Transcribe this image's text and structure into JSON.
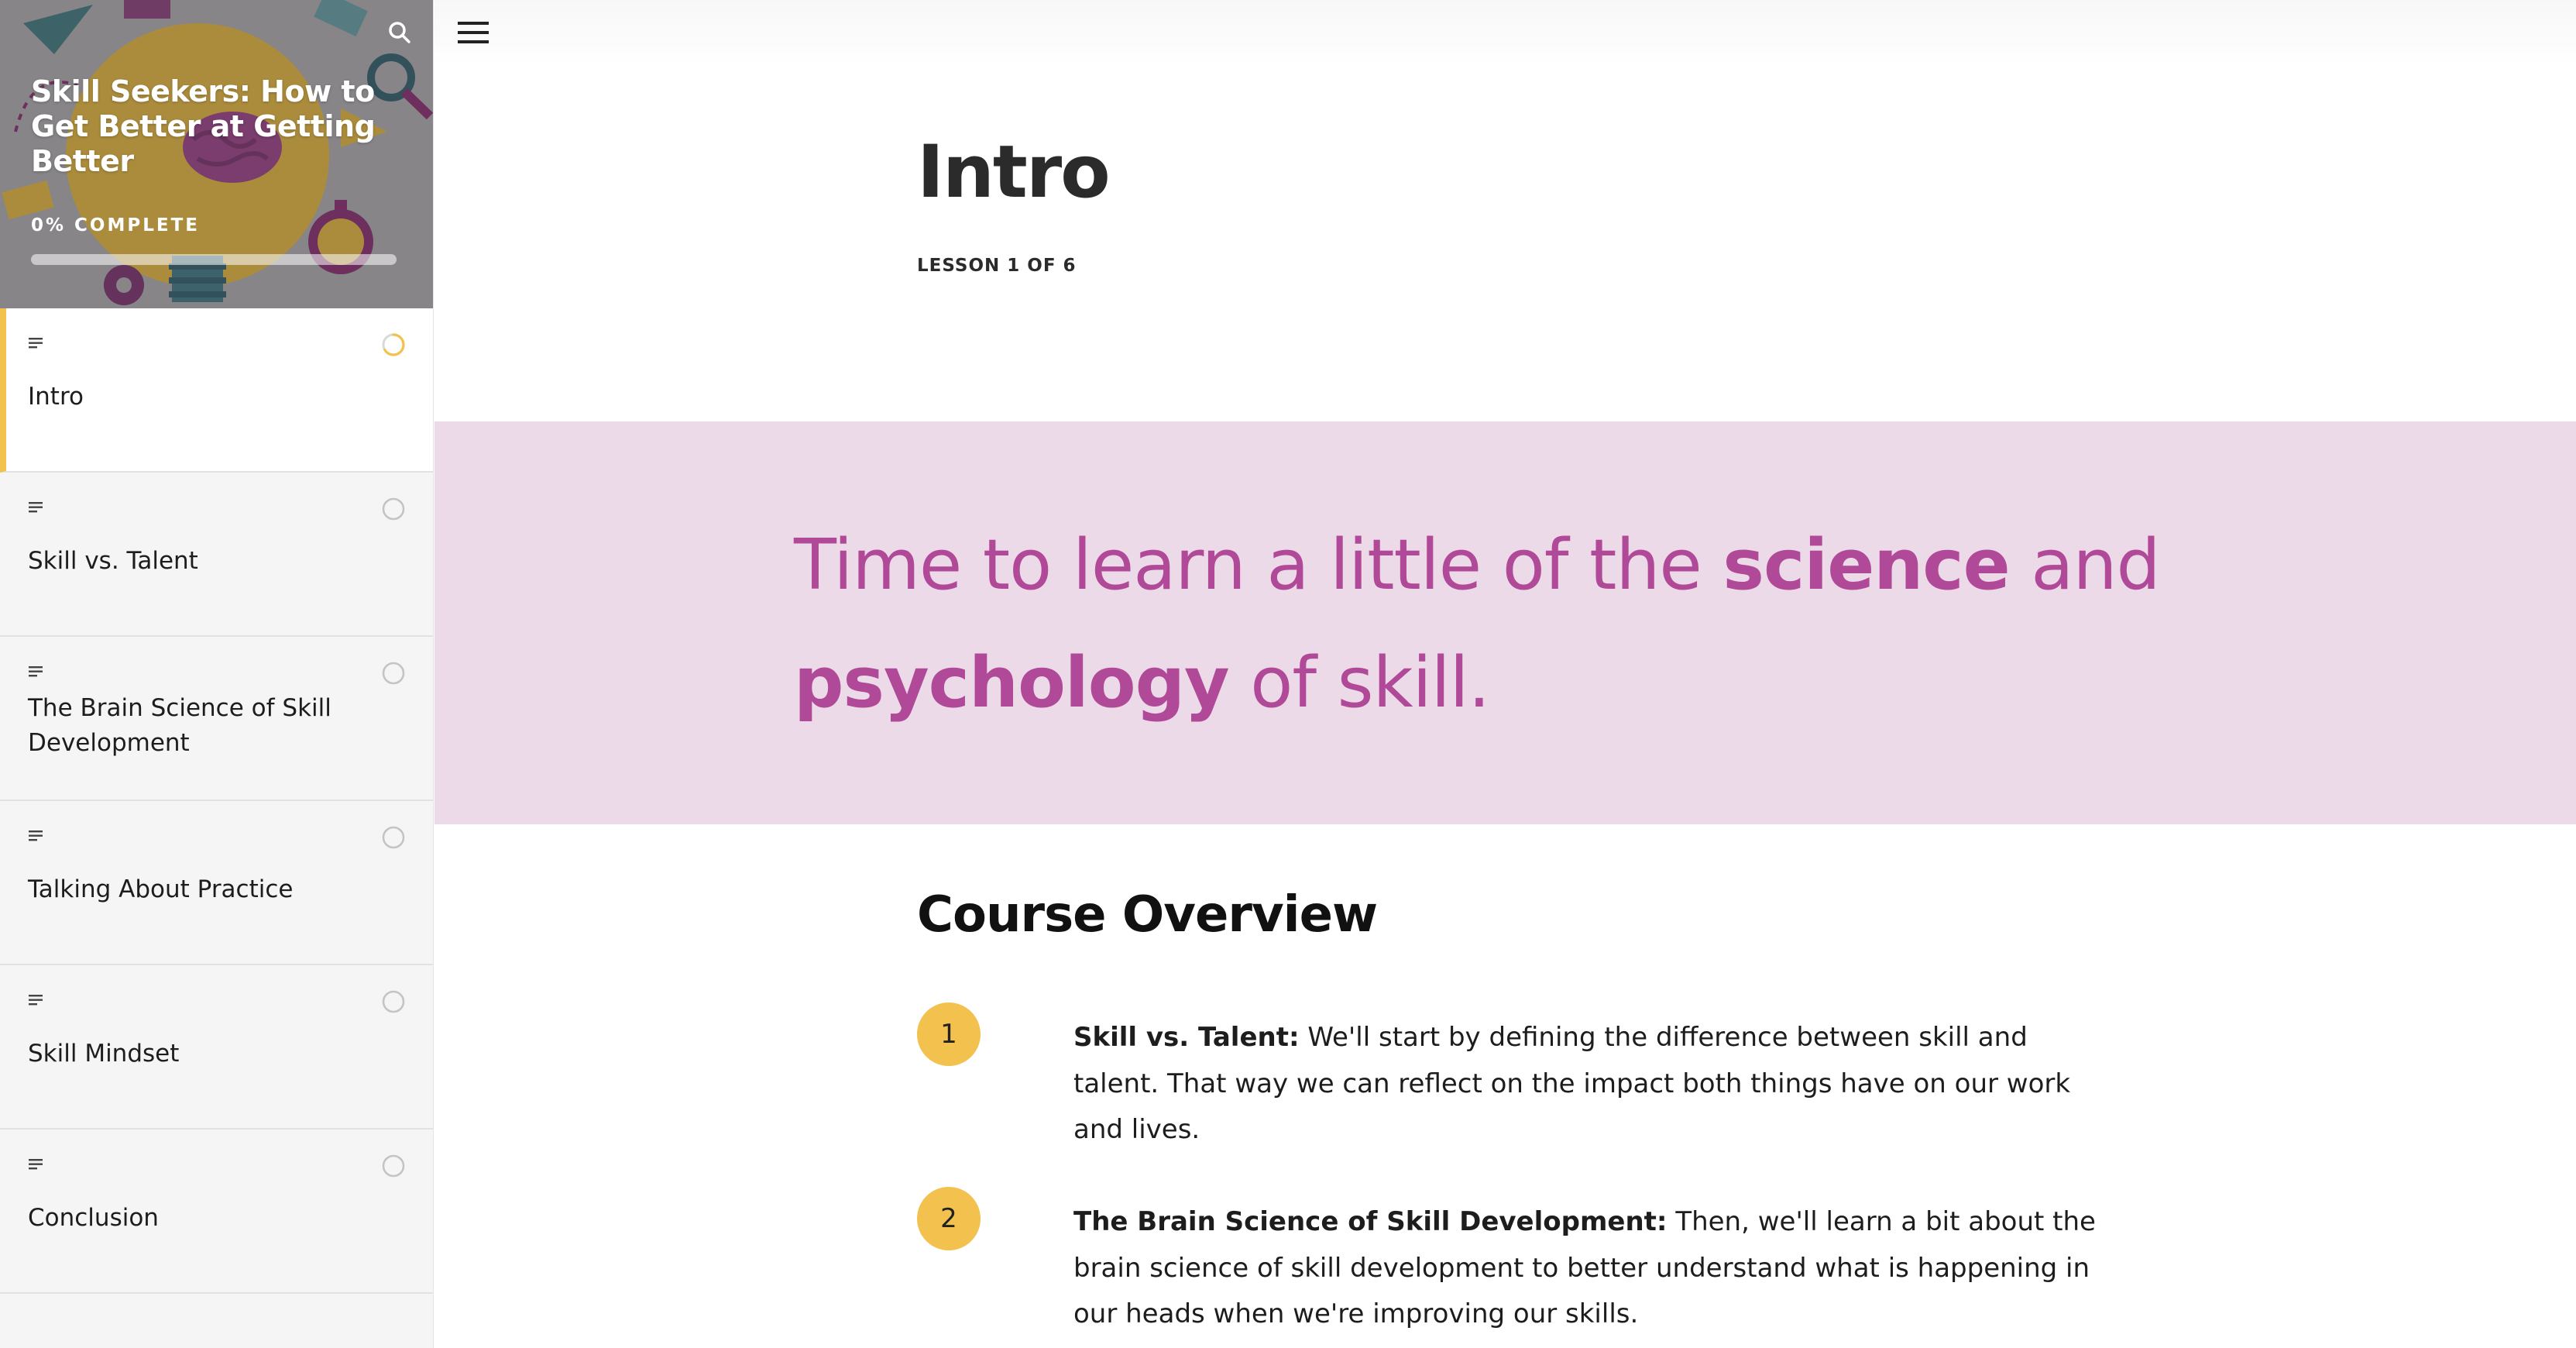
{
  "sidebar": {
    "course_title": "Skill Seekers: How to Get Better at Getting Better",
    "progress_label": "0% COMPLETE",
    "progress_fraction": 0,
    "search_icon": "search-icon",
    "lessons": [
      {
        "label": "Intro",
        "type_icon": "text-lines-icon",
        "status": "in-progress",
        "active": true
      },
      {
        "label": "Skill vs. Talent",
        "type_icon": "text-lines-icon",
        "status": "not-started",
        "active": false
      },
      {
        "label": "The Brain Science of Skill Development",
        "type_icon": "text-lines-icon",
        "status": "not-started",
        "active": false
      },
      {
        "label": "Talking About Practice",
        "type_icon": "text-lines-icon",
        "status": "not-started",
        "active": false
      },
      {
        "label": "Skill Mindset",
        "type_icon": "text-lines-icon",
        "status": "not-started",
        "active": false
      },
      {
        "label": "Conclusion",
        "type_icon": "text-lines-icon",
        "status": "not-started",
        "active": false
      }
    ]
  },
  "topbar": {
    "menu_icon": "hamburger-menu-icon"
  },
  "lesson": {
    "title": "Intro",
    "count": "LESSON 1 OF 6"
  },
  "banner": {
    "parts": [
      {
        "text": "Time to learn a little of the ",
        "bold": false
      },
      {
        "text": "science",
        "bold": true
      },
      {
        "text": " and ",
        "bold": false
      },
      {
        "text": "psychology",
        "bold": true
      },
      {
        "text": " of skill.",
        "bold": false
      }
    ]
  },
  "overview": {
    "heading": "Course Overview",
    "items": [
      {
        "number": "1",
        "title": "Skill vs. Talent:",
        "body": " We'll start by defining the difference between skill and talent. That way we can reflect on the impact both things have on our work and lives."
      },
      {
        "number": "2",
        "title": "The Brain Science of Skill Development:",
        "body": " Then, we'll learn a bit about the brain science of skill development to better understand what is happening in our heads when we're improving our skills."
      }
    ]
  },
  "colors": {
    "accent_yellow": "#f2c14e",
    "banner_bg": "#eddae9",
    "banner_text": "#b04a98",
    "sidebar_bg": "#f5f5f5"
  }
}
